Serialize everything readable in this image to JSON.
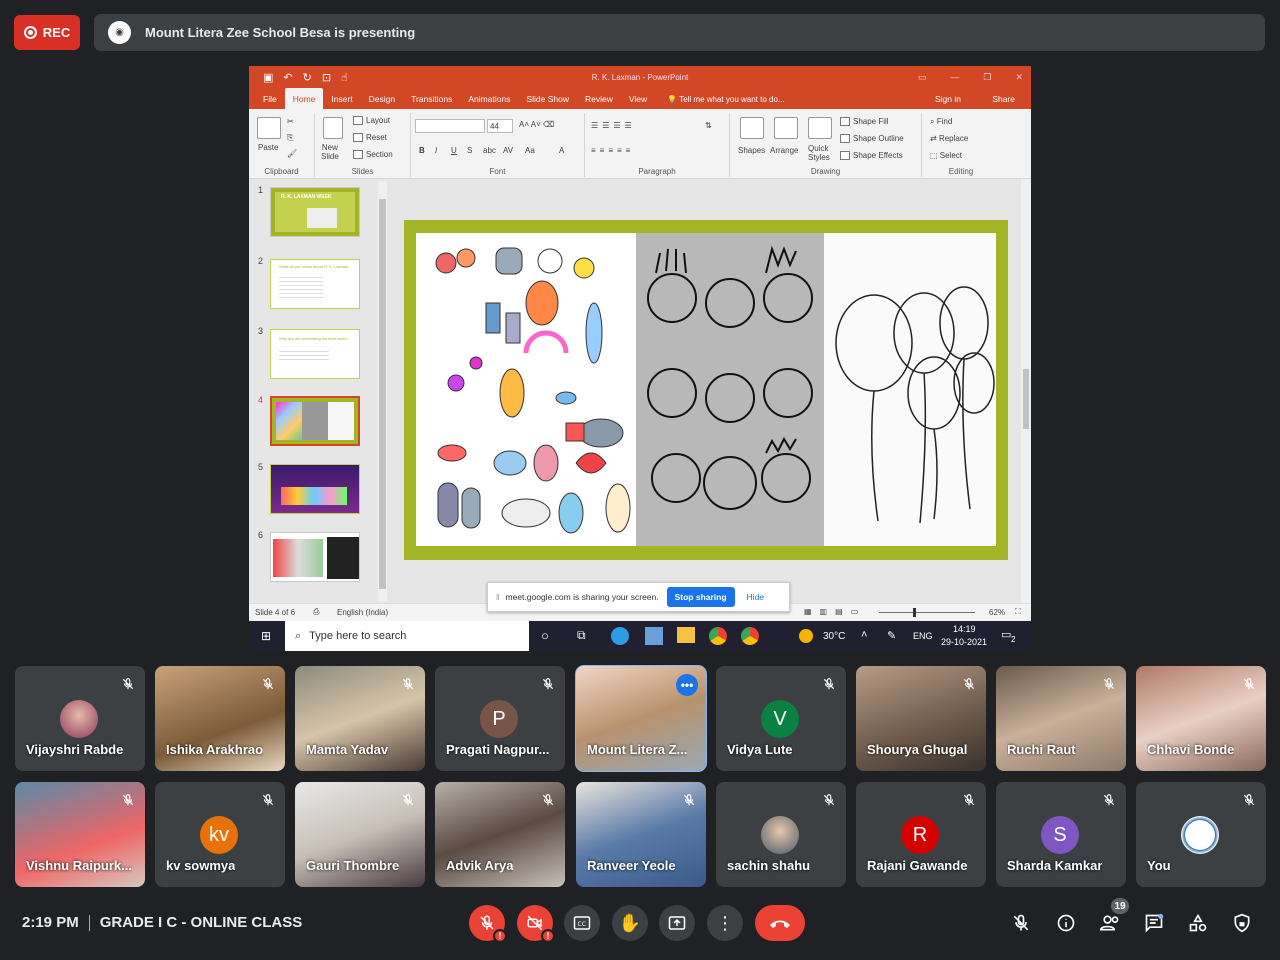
{
  "rec": {
    "label": "REC"
  },
  "presenting": {
    "text": "Mount Litera Zee School Besa is presenting"
  },
  "ppt": {
    "title": "R. K. Laxman - PowerPoint",
    "tabs": [
      "File",
      "Home",
      "Insert",
      "Design",
      "Transitions",
      "Animations",
      "Slide Show",
      "Review",
      "View"
    ],
    "tell_me": "Tell me what you want to do...",
    "sign_in": "Sign in",
    "share": "Share",
    "ribbon": {
      "clipboard": "Clipboard",
      "paste": "Paste",
      "slides": "Slides",
      "new_slide": "New\nSlide",
      "layout": "Layout",
      "reset": "Reset",
      "section": "Section",
      "font": "Font",
      "font_size": "44",
      "paragraph": "Paragraph",
      "drawing": "Drawing",
      "shapes": "Shapes",
      "arrange": "Arrange",
      "quick_styles": "Quick\nStyles",
      "shape_fill": "Shape Fill",
      "shape_outline": "Shape Outline",
      "shape_effects": "Shape Effects",
      "editing": "Editing",
      "find": "Find",
      "replace": "Replace",
      "select": "Select"
    },
    "thumbnails": [
      {
        "num": "1",
        "title": "R. K. LAXMAN WEEK"
      },
      {
        "num": "2",
        "title": "What do you know about R. K. Laxman"
      },
      {
        "num": "3",
        "title": "Why are we celebrating his birth week?"
      },
      {
        "num": "4",
        "title": ""
      },
      {
        "num": "5",
        "title": ""
      },
      {
        "num": "6",
        "title": ""
      }
    ],
    "status": {
      "slide": "Slide 4 of 6",
      "lang": "English (India)",
      "zoom": "62%"
    },
    "sharebar": {
      "text": "meet.google.com is sharing your screen.",
      "stop": "Stop sharing",
      "hide": "Hide"
    },
    "taskbar": {
      "search": "Type here to search",
      "temp": "30°C",
      "lang": "ENG",
      "time": "14:19",
      "date": "29-10-2021",
      "notif": "2"
    }
  },
  "participants": [
    {
      "name": "Vijayshri Rabde"
    },
    {
      "name": "Ishika Arakhrao"
    },
    {
      "name": "Mamta Yadav"
    },
    {
      "name": "Pragati Nagpur...",
      "initial": "P"
    },
    {
      "name": "Mount Litera Z..."
    },
    {
      "name": "Vidya Lute",
      "initial": "V"
    },
    {
      "name": "Shourya Ghugal"
    },
    {
      "name": "Ruchi Raut"
    },
    {
      "name": "Chhavi Bonde"
    },
    {
      "name": "Vishnu Raipurk..."
    },
    {
      "name": "kv sowmya",
      "initial": "kv"
    },
    {
      "name": "Gauri Thombre"
    },
    {
      "name": "Advik Arya"
    },
    {
      "name": "Ranveer Yeole"
    },
    {
      "name": "sachin shahu"
    },
    {
      "name": "Rajani Gawande",
      "initial": "R"
    },
    {
      "name": "Sharda Kamkar",
      "initial": "S"
    },
    {
      "name": "You"
    }
  ],
  "bottom": {
    "time": "2:19 PM",
    "meeting": "GRADE I C - ONLINE CLASS",
    "people_count": "19"
  },
  "colors": {
    "bg": "#202124",
    "tile": "#3c4043",
    "red": "#ea4335",
    "ppt": "#d24726",
    "slide_border": "#a3b526"
  }
}
